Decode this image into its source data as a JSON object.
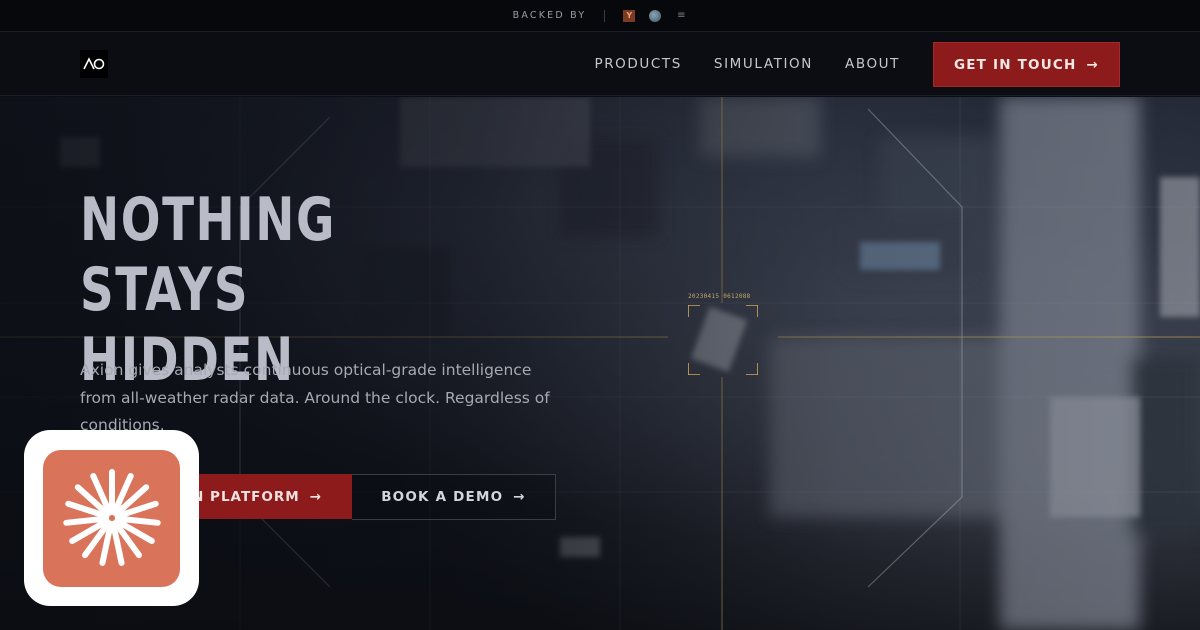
{
  "backed_by": {
    "label": "BACKED BY",
    "backers": [
      {
        "icon": "y-combinator-logo",
        "glyph": "Y"
      },
      {
        "icon": "globe-logo",
        "glyph": ""
      },
      {
        "icon": "lines-logo",
        "glyph": "≡"
      }
    ]
  },
  "nav": {
    "logo_text": "ΛO",
    "links": [
      "PRODUCTS",
      "SIMULATION",
      "ABOUT"
    ],
    "cta_label": "GET IN TOUCH",
    "cta_arrow": "→"
  },
  "hero": {
    "headline_line1": "NOTHING STAYS",
    "headline_line2": "HIDDEN",
    "subtitle": "Axion gives analysts continuous optical-grade intelligence from all-weather radar data. Around the clock. Regardless of conditions.",
    "primary_cta": "ON PLATFORM",
    "primary_arrow": "→",
    "secondary_cta": "BOOK A DEMO",
    "secondary_arrow": "→",
    "target_label": "20230415 0612088"
  },
  "colors": {
    "accent": "#8e1b1b",
    "gold_lines": "#b89a5a",
    "badge_orange": "#d9735a"
  }
}
